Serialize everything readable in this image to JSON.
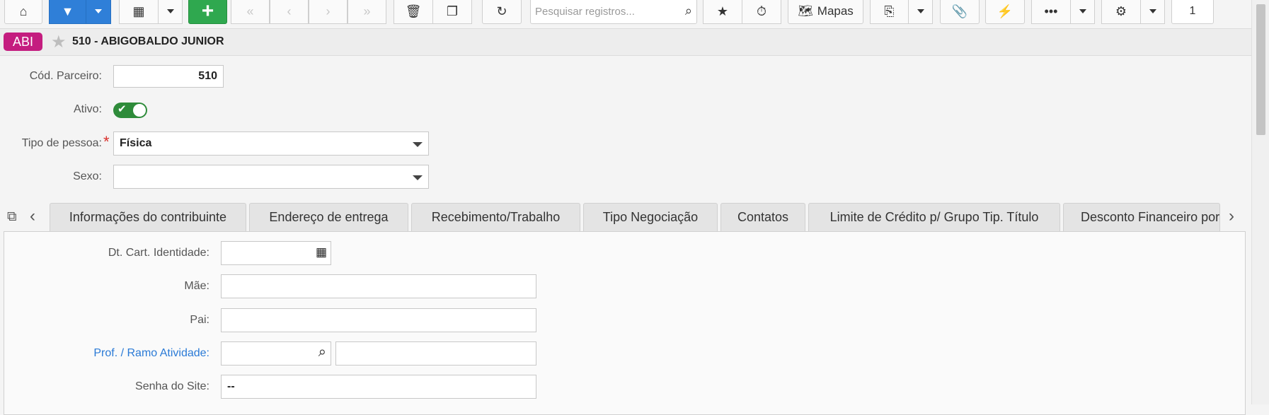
{
  "toolbar": {
    "search_placeholder": "Pesquisar registros...",
    "maps_label": "Mapas",
    "page_count": "1"
  },
  "record": {
    "badge": "ABI",
    "title": "510 - ABIGOBALDO JUNIOR"
  },
  "form": {
    "cod_parceiro_label": "Cód. Parceiro:",
    "cod_parceiro_value": "510",
    "ativo_label": "Ativo:",
    "tipo_pessoa_label": "Tipo de pessoa:",
    "required_mark": "*",
    "tipo_pessoa_value": "Física",
    "sexo_label": "Sexo:",
    "sexo_value": ""
  },
  "tabs": [
    {
      "label": "Informações do contribuinte"
    },
    {
      "label": "Endereço de entrega"
    },
    {
      "label": "Recebimento/Trabalho"
    },
    {
      "label": "Tipo Negociação"
    },
    {
      "label": "Contatos"
    },
    {
      "label": "Limite de Crédito p/ Grupo Tip. Título"
    },
    {
      "label": "Desconto Financeiro por"
    }
  ],
  "panel": {
    "dt_identidade_label": "Dt. Cart. Identidade:",
    "dt_identidade_value": "",
    "mae_label": "Mãe:",
    "mae_value": "",
    "pai_label": "Pai:",
    "pai_value": "",
    "prof_label": "Prof. / Ramo Atividade:",
    "prof_code": "",
    "prof_desc": "",
    "senha_label": "Senha do Site:",
    "senha_value": "--"
  }
}
